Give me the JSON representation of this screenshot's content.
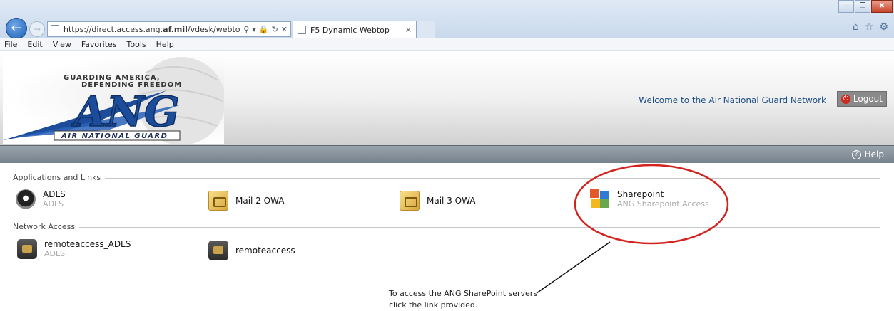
{
  "browser": {
    "url_prefix": "https://direct.access.ang.",
    "url_bold": "af.mil",
    "url_suffix": "/vdesk/webtop.eui?w",
    "tab_title": "F5 Dynamic Webtop",
    "menu": [
      "File",
      "Edit",
      "View",
      "Favorites",
      "Tools",
      "Help"
    ]
  },
  "header": {
    "logo": {
      "tagline_1": "GUARDING AMERICA,",
      "tagline_2": "DEFENDING FREEDOM",
      "mark": "ANG",
      "banner": "AIR NATIONAL GUARD"
    },
    "welcome": "Welcome to the Air National Guard Network",
    "logout": "Logout",
    "help": "Help"
  },
  "sections": {
    "apps_title": "Applications and Links",
    "network_title": "Network Access"
  },
  "apps": [
    {
      "name": "ADLS",
      "sub": "ADLS",
      "icon": "adls-icon"
    },
    {
      "name": "Mail 2 OWA",
      "sub": "",
      "icon": "mail-icon"
    },
    {
      "name": "Mail 3 OWA",
      "sub": "",
      "icon": "mail-icon"
    },
    {
      "name": "Sharepoint",
      "sub": "ANG Sharepoint Access",
      "icon": "sharepoint-icon"
    }
  ],
  "network": [
    {
      "name": "remoteaccess_ADLS",
      "sub": "ADLS",
      "icon": "network-access-icon"
    },
    {
      "name": "remoteaccess",
      "sub": "",
      "icon": "network-access-icon"
    }
  ],
  "annotation": {
    "line1": "To access the ANG SharePoint servers",
    "line2": "click the link provided."
  },
  "colors": {
    "annotation_circle": "#d2231f",
    "welcome_text": "#1f4e85",
    "logo_blue": "#1d4d9a"
  }
}
